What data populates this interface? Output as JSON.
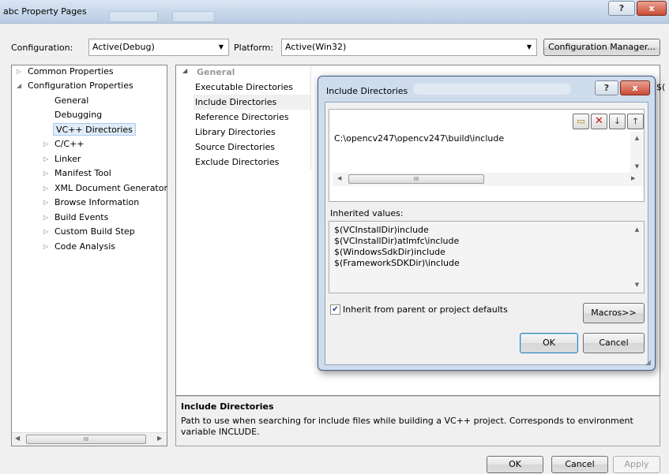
{
  "window": {
    "title": "abc Property Pages",
    "help_glyph": "?",
    "close_glyph": "x"
  },
  "config_row": {
    "configuration_label": "Configuration:",
    "configuration_value": "Active(Debug)",
    "platform_label": "Platform:",
    "platform_value": "Active(Win32)",
    "config_manager_label": "Configuration Manager..."
  },
  "tree": {
    "items": [
      {
        "label": "Common Properties",
        "expanded": false
      },
      {
        "label": "Configuration Properties",
        "expanded": true
      },
      {
        "label": "General"
      },
      {
        "label": "Debugging"
      },
      {
        "label": "VC++ Directories",
        "selected": true
      },
      {
        "label": "C/C++",
        "expanded": false
      },
      {
        "label": "Linker",
        "expanded": false
      },
      {
        "label": "Manifest Tool",
        "expanded": false
      },
      {
        "label": "XML Document Generator",
        "expanded": false
      },
      {
        "label": "Browse Information",
        "expanded": false
      },
      {
        "label": "Build Events",
        "expanded": false
      },
      {
        "label": "Custom Build Step",
        "expanded": false
      },
      {
        "label": "Code Analysis",
        "expanded": false
      }
    ],
    "scroll_thumb_glyph": "III"
  },
  "grid": {
    "category": "General",
    "rows": [
      "Executable Directories",
      "Include Directories",
      "Reference Directories",
      "Library Directories",
      "Source Directories",
      "Exclude Directories"
    ]
  },
  "description": {
    "title": "Include Directories",
    "text": "Path to use when searching for include files while building a VC++ project.  Corresponds to environment variable INCLUDE."
  },
  "footer": {
    "ok": "OK",
    "cancel": "Cancel",
    "apply": "Apply"
  },
  "dialog": {
    "title": "Include Directories",
    "help_glyph": "?",
    "close_glyph": "x",
    "entries": [
      "C:\\opencv247\\opencv247\\build\\include"
    ],
    "hscroll_thumb_glyph": "III",
    "inherited_label": "Inherited values:",
    "inherited_values": [
      "$(VCInstallDir)include",
      "$(VCInstallDir)atlmfc\\include",
      "$(WindowsSdkDir)include",
      "$(FrameworkSDKDir)\\include"
    ],
    "inherit_checkbox_label": "Inherit from parent or project defaults",
    "inherit_checked": true,
    "macros_label": "Macros>>",
    "ok_label": "OK",
    "cancel_label": "Cancel"
  }
}
